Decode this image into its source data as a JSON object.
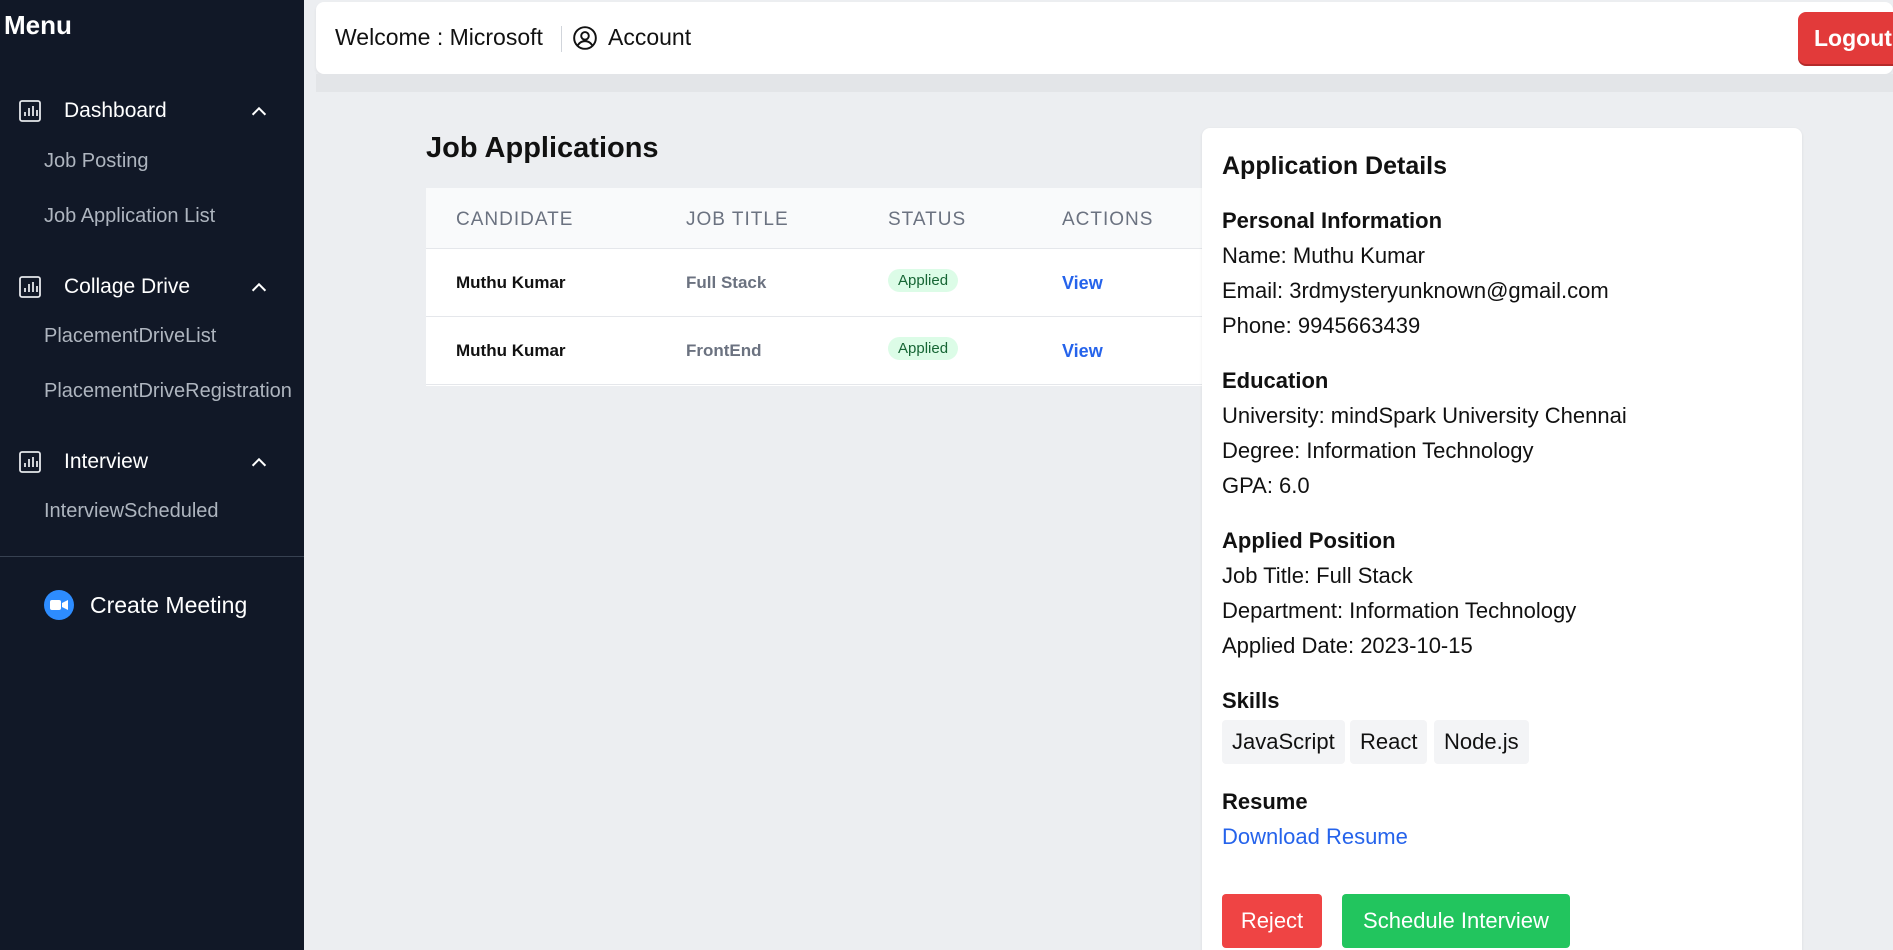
{
  "sidebar": {
    "menu_title": "Menu",
    "sections": [
      {
        "label": "Dashboard",
        "items": [
          "Job Posting",
          "Job Application List"
        ]
      },
      {
        "label": "Collage Drive",
        "items": [
          "PlacementDriveList",
          "PlacementDriveRegistration"
        ]
      },
      {
        "label": "Interview",
        "items": [
          "InterviewScheduled"
        ]
      }
    ],
    "create_meeting": "Create Meeting"
  },
  "header": {
    "welcome": "Welcome : Microsoft",
    "account": "Account",
    "logout": "Logout"
  },
  "main": {
    "title": "Job Applications",
    "columns": [
      "CANDIDATE",
      "JOB TITLE",
      "STATUS",
      "ACTIONS"
    ],
    "rows": [
      {
        "candidate": "Muthu Kumar",
        "job_title": "Full Stack",
        "status": "Applied",
        "action": "View"
      },
      {
        "candidate": "Muthu Kumar",
        "job_title": "FrontEnd",
        "status": "Applied",
        "action": "View"
      }
    ]
  },
  "details": {
    "title": "Application Details",
    "personal_heading": "Personal Information",
    "name": "Name: Muthu Kumar",
    "email": "Email: 3rdmysteryunknown@gmail.com",
    "phone": "Phone: 9945663439",
    "education_heading": "Education",
    "university": "University: mindSpark University Chennai",
    "degree": "Degree: Information Technology",
    "gpa": "GPA: 6.0",
    "position_heading": "Applied Position",
    "job_title": "Job Title: Full Stack",
    "department": "Department: Information Technology",
    "applied_date": "Applied Date: 2023-10-15",
    "skills_heading": "Skills",
    "skills": [
      "JavaScript",
      "React",
      "Node.js"
    ],
    "resume_heading": "Resume",
    "download": "Download Resume",
    "reject": "Reject",
    "schedule": "Schedule Interview"
  },
  "colors": {
    "sidebar_bg": "#111827",
    "logout": "#e23a3a",
    "reject": "#ef4444",
    "schedule": "#22c55e",
    "link": "#2563eb",
    "badge_bg": "#dcfce7"
  },
  "icons": {
    "section": "bar-chart-icon",
    "chevron": "chevron-up-icon",
    "account": "user-circle-icon",
    "meeting": "video-camera-icon"
  }
}
